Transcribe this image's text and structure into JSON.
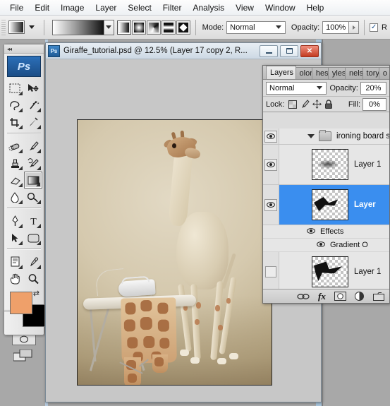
{
  "app": {
    "name": "Adobe Photoshop",
    "logo_text": "Ps"
  },
  "menubar": {
    "items": [
      {
        "label": "File"
      },
      {
        "label": "Edit"
      },
      {
        "label": "Image"
      },
      {
        "label": "Layer"
      },
      {
        "label": "Select"
      },
      {
        "label": "Filter"
      },
      {
        "label": "Analysis"
      },
      {
        "label": "View"
      },
      {
        "label": "Window"
      },
      {
        "label": "Help"
      }
    ]
  },
  "options_bar": {
    "tool": "gradient-tool",
    "gradient_preset_label": "",
    "gradient_types": [
      {
        "name": "linear-gradient",
        "selected": true
      },
      {
        "name": "radial-gradient",
        "selected": false
      },
      {
        "name": "angle-gradient",
        "selected": false
      },
      {
        "name": "reflected-gradient",
        "selected": false
      },
      {
        "name": "diamond-gradient",
        "selected": false
      }
    ],
    "mode_label": "Mode:",
    "mode_value": "Normal",
    "opacity_label": "Opacity:",
    "opacity_value": "100%",
    "reverse_label": "R",
    "reverse_checked": true,
    "check_glyph": "✓"
  },
  "toolbar": {
    "collapse_glyph": "◂◂",
    "tools": [
      {
        "name": "rectangular-marquee-tool",
        "selected": false
      },
      {
        "name": "move-tool",
        "selected": false
      },
      {
        "name": "lasso-tool",
        "selected": false
      },
      {
        "name": "magic-wand-tool",
        "selected": false
      },
      {
        "name": "crop-tool",
        "selected": false
      },
      {
        "name": "eyedropper-slice-tool",
        "selected": false
      },
      {
        "name": "healing-brush-tool",
        "selected": false
      },
      {
        "name": "brush-tool",
        "selected": false
      },
      {
        "name": "clone-stamp-tool",
        "selected": false
      },
      {
        "name": "history-brush-tool",
        "selected": false
      },
      {
        "name": "eraser-tool",
        "selected": false
      },
      {
        "name": "gradient-tool",
        "selected": true
      },
      {
        "name": "blur-tool",
        "selected": false
      },
      {
        "name": "dodge-tool",
        "selected": false
      },
      {
        "name": "pen-tool",
        "selected": false
      },
      {
        "name": "type-tool",
        "selected": false
      },
      {
        "name": "path-selection-tool",
        "selected": false
      },
      {
        "name": "rectangle-shape-tool",
        "selected": false
      },
      {
        "name": "notes-tool",
        "selected": false
      },
      {
        "name": "eyedropper-tool",
        "selected": false
      },
      {
        "name": "hand-tool",
        "selected": false
      },
      {
        "name": "zoom-tool",
        "selected": false
      }
    ],
    "foreground_color": "#efa06a",
    "background_color": "#000000",
    "swap_glyph": "⇄",
    "quick_mask_label": "",
    "screen_mode_label": ""
  },
  "document_window": {
    "title": "Giraffe_tutorial.psd @ 12.5% (Layer 17 copy 2, R...",
    "icon_text": "Ps",
    "minimize_label": "",
    "maximize_label": "",
    "close_label": "✕",
    "zoom_level": "12.5%"
  },
  "layers_panel": {
    "tabs": [
      {
        "label": "Layers",
        "active": true,
        "close_glyph": "✕"
      },
      {
        "label": "olor",
        "active": false
      },
      {
        "label": "hes",
        "active": false
      },
      {
        "label": "yles",
        "active": false
      },
      {
        "label": "nels",
        "active": false
      },
      {
        "label": "tory",
        "active": false
      },
      {
        "label": "o",
        "active": false
      }
    ],
    "blend_mode": "Normal",
    "opacity_label": "Opacity:",
    "opacity_value": "20%",
    "lock_label": "Lock:",
    "lock_icons": [
      "lock-transparent-pixels-icon",
      "lock-image-pixels-icon",
      "lock-position-icon",
      "lock-all-icon"
    ],
    "fill_label": "Fill:",
    "fill_value": "0%",
    "rows": [
      {
        "kind": "group",
        "name": "ironing board sha",
        "visible": true,
        "expanded": true,
        "selected": false
      },
      {
        "kind": "layer",
        "name": "Layer 1",
        "visible": true,
        "selected": false,
        "thumb": "shadowy"
      },
      {
        "kind": "layer",
        "name": "Layer",
        "visible": true,
        "selected": true,
        "thumb": "inkA"
      },
      {
        "kind": "effects",
        "name": "Effects",
        "visible": true
      },
      {
        "kind": "effect-sub",
        "name": "Gradient O",
        "visible": true
      },
      {
        "kind": "layer",
        "name": "Layer 1",
        "visible": false,
        "selected": false,
        "thumb": "inkB"
      }
    ],
    "bottom_buttons": [
      {
        "name": "link-layers-button",
        "glyph": "⚭"
      },
      {
        "name": "layer-style-button",
        "glyph": "fx"
      },
      {
        "name": "layer-mask-button",
        "glyph": ""
      },
      {
        "name": "adjustment-layer-button",
        "glyph": ""
      },
      {
        "name": "new-group-button",
        "glyph": ""
      }
    ]
  }
}
